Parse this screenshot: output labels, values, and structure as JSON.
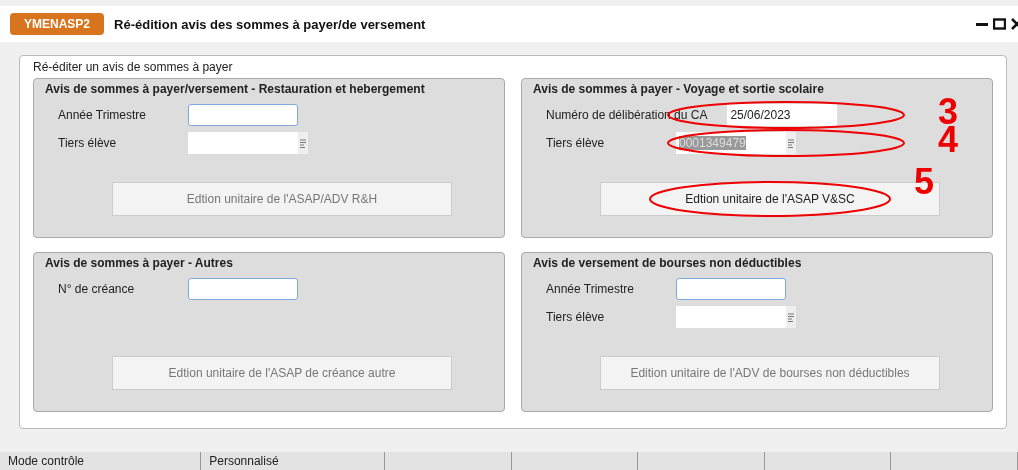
{
  "window": {
    "code": "YMENASP2",
    "title": "Ré-édition avis des sommes à payer/de versement"
  },
  "group": {
    "title": "Ré-éditer un avis de sommes à payer",
    "panels": [
      {
        "title": "Avis de sommes à payer/versement - Restauration et hebergement",
        "fields": [
          {
            "label": "Année Trimestre",
            "kind": "input"
          },
          {
            "label": "Tiers élève",
            "kind": "lookup"
          }
        ],
        "button": {
          "label": "Edtion unitaire de l'ASAP/ADV R&H",
          "disabled": true
        }
      },
      {
        "title": "Avis de sommes à payer - Voyage et sortie scolaire",
        "fields": [
          {
            "label": "Numéro de délibération du CA",
            "kind": "text",
            "value": "25/06/2023",
            "annotation": "3"
          },
          {
            "label": "Tiers élève",
            "kind": "lookup",
            "value": "0001349479",
            "value_selected": true,
            "annotation": "4"
          }
        ],
        "button": {
          "label": "Edtion unitaire de l'ASAP V&SC",
          "disabled": false,
          "annotation": "5"
        }
      },
      {
        "title": "Avis de sommes à payer - Autres",
        "fields": [
          {
            "label": "N° de créance",
            "kind": "input"
          }
        ],
        "button": {
          "label": "Edtion unitaire de l'ASAP de créance autre",
          "disabled": true
        }
      },
      {
        "title": "Avis de versement de bourses non déductibles",
        "fields": [
          {
            "label": "Année Trimestre",
            "kind": "input"
          },
          {
            "label": "Tiers élève",
            "kind": "lookup"
          }
        ],
        "button": {
          "label": "Edition unitaire de l'ADV de bourses non déductibles",
          "disabled": true
        }
      }
    ]
  },
  "status_bar": [
    "Mode contrôle",
    "Personnalisé"
  ]
}
